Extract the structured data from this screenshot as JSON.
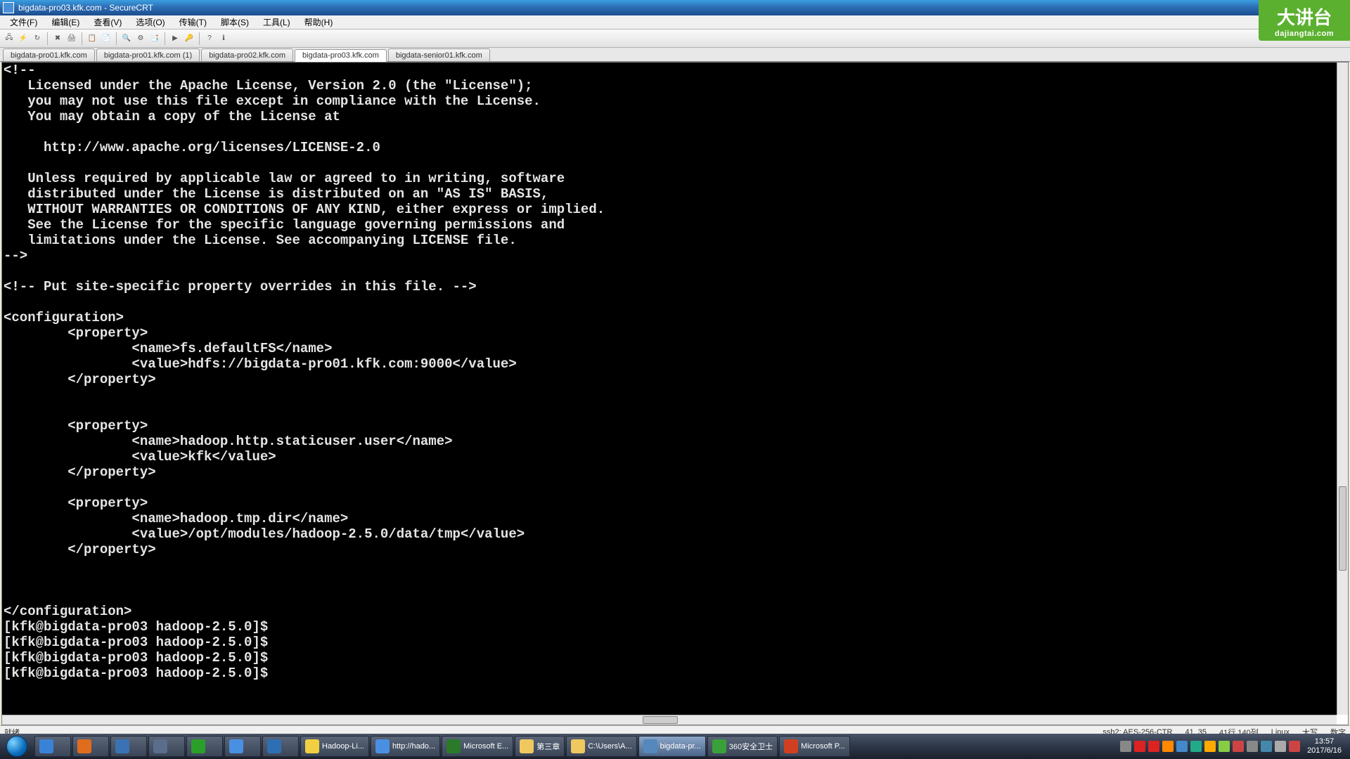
{
  "window": {
    "title": "bigdata-pro03.kfk.com - SecureCRT",
    "extra_title": ""
  },
  "watermark": {
    "main": "大讲台",
    "sub": "dajiangtai.com"
  },
  "menu": {
    "items": [
      "文件(F)",
      "编辑(E)",
      "查看(V)",
      "选项(O)",
      "传输(T)",
      "脚本(S)",
      "工具(L)",
      "帮助(H)"
    ]
  },
  "tabs": {
    "items": [
      {
        "label": "bigdata-pro01.kfk.com",
        "active": false
      },
      {
        "label": "bigdata-pro01.kfk.com (1)",
        "active": false
      },
      {
        "label": "bigdata-pro02.kfk.com",
        "active": false
      },
      {
        "label": "bigdata-pro03.kfk.com",
        "active": true
      },
      {
        "label": "bigdata-senior01.kfk.com",
        "active": false
      }
    ]
  },
  "terminal": {
    "content": "<!--\n   Licensed under the Apache License, Version 2.0 (the \"License\");\n   you may not use this file except in compliance with the License.\n   You may obtain a copy of the License at\n\n     http://www.apache.org/licenses/LICENSE-2.0\n\n   Unless required by applicable law or agreed to in writing, software\n   distributed under the License is distributed on an \"AS IS\" BASIS,\n   WITHOUT WARRANTIES OR CONDITIONS OF ANY KIND, either express or implied.\n   See the License for the specific language governing permissions and\n   limitations under the License. See accompanying LICENSE file.\n-->\n\n<!-- Put site-specific property overrides in this file. -->\n\n<configuration>\n        <property>\n                <name>fs.defaultFS</name>\n                <value>hdfs://bigdata-pro01.kfk.com:9000</value>\n        </property>\n\n\n        <property>\n                <name>hadoop.http.staticuser.user</name>\n                <value>kfk</value>\n        </property>\n\n        <property>\n                <name>hadoop.tmp.dir</name>\n                <value>/opt/modules/hadoop-2.5.0/data/tmp</value>\n        </property>\n\n\n\n</configuration>\n[kfk@bigdata-pro03 hadoop-2.5.0]$\n[kfk@bigdata-pro03 hadoop-2.5.0]$\n[kfk@bigdata-pro03 hadoop-2.5.0]$\n[kfk@bigdata-pro03 hadoop-2.5.0]$"
  },
  "statusbar": {
    "ready": "就绪",
    "conn": "ssh2: AES-256-CTR",
    "pos": "41, 35",
    "size": "41行,140列",
    "term": "Linux",
    "caps": "大写",
    "num": "数字"
  },
  "taskbar": {
    "items": [
      {
        "label": "",
        "icon_color": "#3a82d7"
      },
      {
        "label": "",
        "icon_color": "#e06c1e"
      },
      {
        "label": "",
        "icon_color": "#3a72b5"
      },
      {
        "label": "",
        "icon_color": "#5a6d8a"
      },
      {
        "label": "",
        "icon_color": "#2aa02a"
      },
      {
        "label": "",
        "icon_color": "#4a90e2"
      },
      {
        "label": "",
        "icon_color": "#2d6fb5"
      },
      {
        "label": "Hadoop-Li...",
        "icon_color": "#f0d040"
      },
      {
        "label": "http://hado...",
        "icon_color": "#4a90e2"
      },
      {
        "label": "Microsoft E...",
        "icon_color": "#2a7a2a"
      },
      {
        "label": "第三章",
        "icon_color": "#f0c860"
      },
      {
        "label": "C:\\Users\\A...",
        "icon_color": "#f0c860"
      },
      {
        "label": "bigdata-pr...",
        "icon_color": "#5588bb",
        "active": true
      },
      {
        "label": "360安全卫士",
        "icon_color": "#3aa03a"
      },
      {
        "label": "Microsoft P...",
        "icon_color": "#d04020"
      }
    ],
    "clock_time": "13:57",
    "clock_date": "2017/6/16"
  }
}
